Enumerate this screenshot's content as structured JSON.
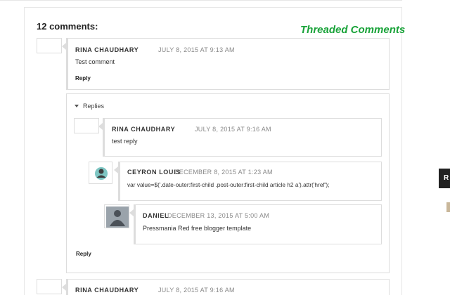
{
  "section": {
    "heading": "12 comments:",
    "watermark": "Threaded Comments"
  },
  "comments": [
    {
      "author": "RINA CHAUDHARY",
      "date": "JULY 8, 2015 AT 9:13 AM",
      "text": "Test comment",
      "reply_label": "Reply",
      "replies_label": "Replies",
      "replies": [
        {
          "author": "RINA CHAUDHARY",
          "date": "JULY 8, 2015 AT 9:16 AM",
          "text": "test reply"
        },
        {
          "author": "CEYRON LOUIS",
          "date": "DECEMBER 8, 2015 AT 1:23 AM",
          "text": "var value=$('.date-outer:first-child .post-outer:first-child article h2 a').attr('href');"
        },
        {
          "author": "DANIEL",
          "date": "DECEMBER 13, 2015 AT 5:00 AM",
          "text": "Pressmania Red free blogger template"
        }
      ],
      "thread_reply_label": "Reply"
    },
    {
      "author": "RINA CHAUDHARY",
      "date": "JULY 8, 2015 AT 9:16 AM"
    }
  ],
  "sidebar": {
    "badge": "R"
  },
  "colors": {
    "watermark": "#1aa33a",
    "border": "#dddddd"
  }
}
